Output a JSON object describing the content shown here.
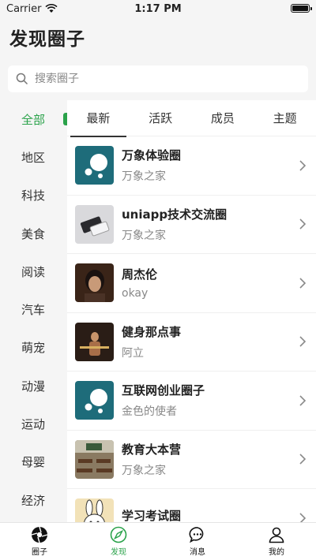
{
  "status": {
    "carrier": "Carrier",
    "time": "1:17 PM"
  },
  "page_title": "发现圈子",
  "search": {
    "placeholder": "搜索圈子"
  },
  "categories": [
    "全部",
    "地区",
    "科技",
    "美食",
    "阅读",
    "汽车",
    "萌宠",
    "动漫",
    "运动",
    "母婴",
    "经济"
  ],
  "active_category": "全部",
  "tabs": [
    "最新",
    "活跃",
    "成员",
    "主题"
  ],
  "active_tab": "最新",
  "list": [
    {
      "title": "万象体验圈",
      "sub": "万象之家",
      "thumb": "logo-icon"
    },
    {
      "title": "uniapp技术交流圈",
      "sub": "万象之家",
      "thumb": "device-photo"
    },
    {
      "title": "周杰伦",
      "sub": "okay",
      "thumb": "portrait-photo"
    },
    {
      "title": "健身那点事",
      "sub": "阿立",
      "thumb": "fitness-photo"
    },
    {
      "title": "互联网创业圈子",
      "sub": "金色的使者",
      "thumb": "logo-icon"
    },
    {
      "title": "教育大本营",
      "sub": "万象之家",
      "thumb": "classroom-photo"
    },
    {
      "title": "学习考试圈",
      "sub": "",
      "thumb": "cartoon-photo"
    }
  ],
  "tabbar": [
    {
      "label": "圈子",
      "icon": "aperture-icon"
    },
    {
      "label": "发现",
      "icon": "compass-icon"
    },
    {
      "label": "消息",
      "icon": "chat-icon"
    },
    {
      "label": "我的",
      "icon": "user-icon"
    }
  ],
  "colors": {
    "accent": "#2aa24a",
    "logo_bg": "#1e6c7a"
  }
}
